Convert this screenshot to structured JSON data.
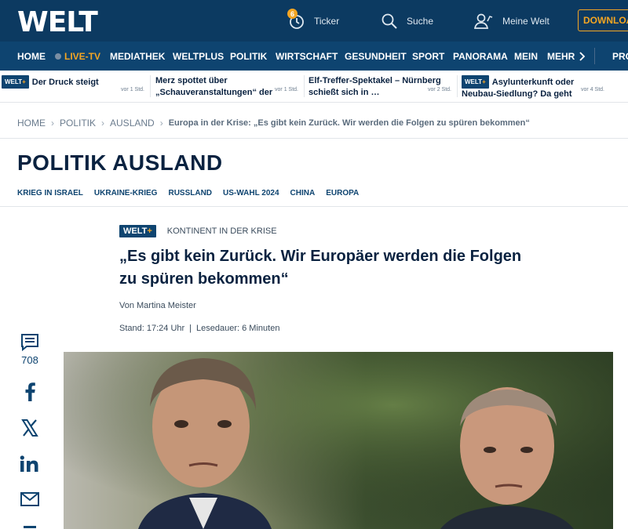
{
  "header": {
    "logo": "WELT",
    "ticker_count": "6",
    "ticker_label": "Ticker",
    "search_label": "Suche",
    "account_label": "Meine Welt",
    "download_label": "DOWNLOAD"
  },
  "nav": {
    "items": [
      "HOME",
      "LIVE-TV",
      "MEDIATHEK",
      "WELTPLUS",
      "POLITIK",
      "WIRTSCHAFT",
      "GESUNDHEIT",
      "SPORT",
      "PANORAMA",
      "MEIN",
      "MEHR",
      "PRO"
    ]
  },
  "teasers": [
    {
      "badge": "WELT+",
      "title": "Der Druck steigt",
      "time": "vor 1 Std."
    },
    {
      "badge": "",
      "title": "Merz spottet über „Schauveranstaltungen“ der",
      "time": "vor 1 Std."
    },
    {
      "badge": "",
      "title": "Elf-Treffer-Spektakel – Nürnberg schießt sich in …",
      "time": "vor 2 Std."
    },
    {
      "badge": "WELT+",
      "title": "Asylunterkunft oder Neubau-Siedlung? Da geht es",
      "time": "vor 4 Std."
    }
  ],
  "badge_parts": {
    "word": "WELT",
    "plus": "+"
  },
  "breadcrumb": {
    "items": [
      "HOME",
      "POLITIK",
      "AUSLAND"
    ],
    "current": "Europa in der Krise: „Es gibt kein Zurück. Wir werden die Folgen zu spüren bekommen“"
  },
  "section": {
    "title": "POLITIK AUSLAND",
    "subnav": [
      "KRIEG IN ISRAEL",
      "UKRAINE-KRIEG",
      "RUSSLAND",
      "US-WAHL 2024",
      "CHINA",
      "EUROPA"
    ]
  },
  "article": {
    "kicker": "KONTINENT IN DER KRISE",
    "headline_line1": "„Es gibt kein Zurück. Wir Europäer werden die Folgen",
    "headline_line2": "zu spüren bekommen“",
    "author": "Von Martina Meister",
    "stand": "Stand: 17:24 Uhr",
    "separator": "|",
    "read_time": "Lesedauer: 6 Minuten"
  },
  "social": {
    "comment_count": "708",
    "icons": [
      "comment-icon",
      "facebook-icon",
      "x-icon",
      "linkedin-icon",
      "mail-icon"
    ]
  },
  "colors": {
    "brand_dark": "#0c3a61",
    "nav": "#0e4470",
    "accent": "#f5a623"
  }
}
